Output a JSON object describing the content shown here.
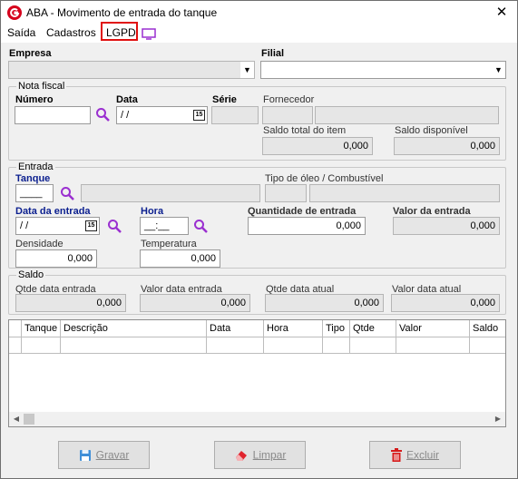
{
  "window": {
    "title": "ABA - Movimento de entrada do tanque",
    "close_glyph": "✕"
  },
  "menu": {
    "items": [
      "Saída",
      "Cadastros",
      "LGPD"
    ]
  },
  "empresa": {
    "label": "Empresa",
    "value": ""
  },
  "filial": {
    "label": "Filial",
    "value": ""
  },
  "nota_fiscal": {
    "group_title": "Nota fiscal",
    "numero_label": "Número",
    "data_label": "Data",
    "data_value": " /  /",
    "serie_label": "Série",
    "fornecedor_label": "Fornecedor",
    "saldo_total_label": "Saldo total do item",
    "saldo_total_value": "0,000",
    "saldo_disp_label": "Saldo disponível",
    "saldo_disp_value": "0,000"
  },
  "entrada": {
    "group_title": "Entrada",
    "tanque_label": "Tanque",
    "tanque_value": "____",
    "tipo_oleo_label": "Tipo de óleo / Combustível",
    "data_entrada_label": "Data da entrada",
    "data_entrada_value": " /  /",
    "hora_label": "Hora",
    "hora_value": "__:__",
    "quantidade_label": "Quantidade de entrada",
    "quantidade_value": "0,000",
    "valor_label": "Valor da entrada",
    "valor_value": "0,000",
    "densidade_label": "Densidade",
    "densidade_value": "0,000",
    "temperatura_label": "Temperatura",
    "temperatura_value": "0,000"
  },
  "saldo": {
    "group_title": "Saldo",
    "qtde_data_entrada_label": "Qtde data entrada",
    "qtde_data_entrada_value": "0,000",
    "valor_data_entrada_label": "Valor data entrada",
    "valor_data_entrada_value": "0,000",
    "qtde_data_atual_label": "Qtde data atual",
    "qtde_data_atual_value": "0,000",
    "valor_data_atual_label": "Valor data atual",
    "valor_data_atual_value": "0,000"
  },
  "grid": {
    "columns": [
      "Tanque",
      "Descrição",
      "Data",
      "Hora",
      "Tipo",
      "Qtde",
      "Valor",
      "Saldo"
    ]
  },
  "buttons": {
    "gravar": "Gravar",
    "limpar": "Limpar",
    "excluir": "Excluir"
  },
  "calendar_day": "15",
  "colors": {
    "accent": "#d6001c",
    "label_blue": "#0b1f8f",
    "icon_purple": "#9a2fd0",
    "lgpd_highlight": "#e01010"
  }
}
